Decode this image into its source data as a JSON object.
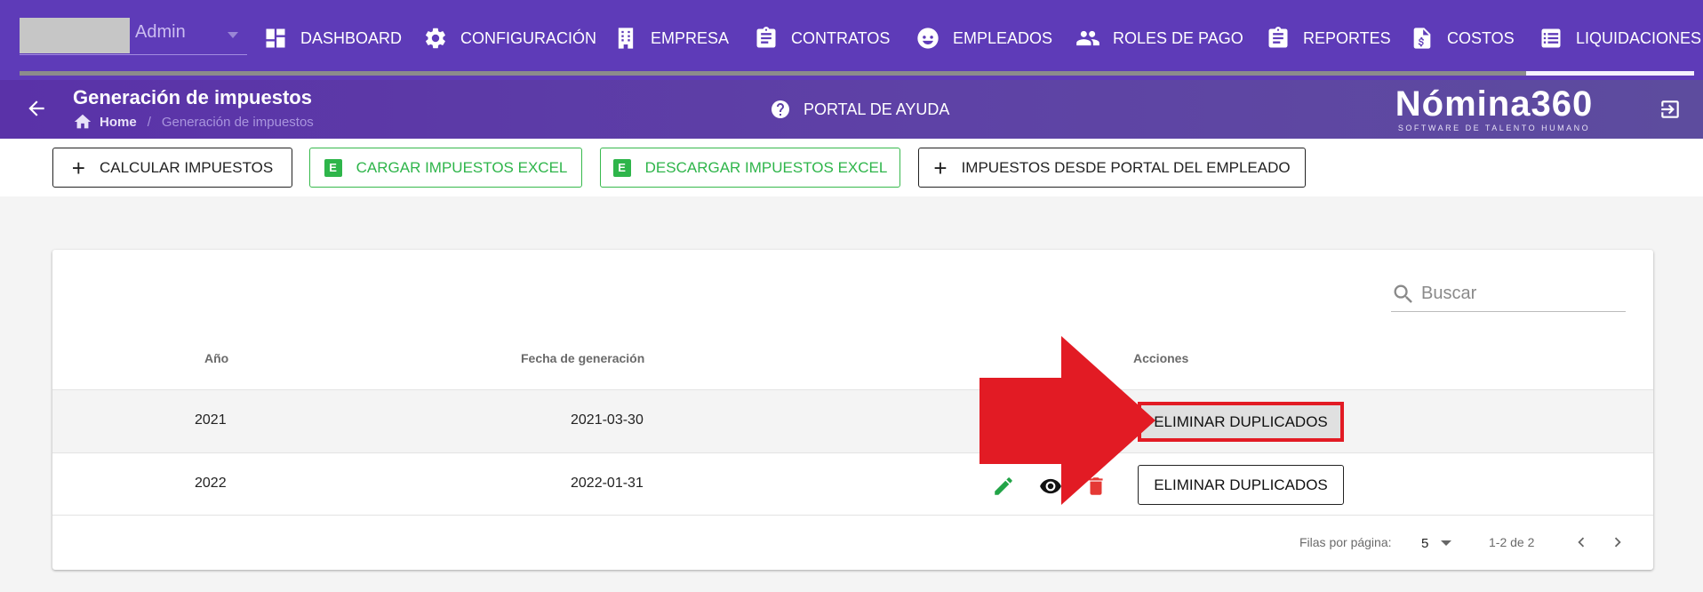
{
  "nav": {
    "user": {
      "name": "Admin"
    },
    "items": [
      {
        "label": "DASHBOARD",
        "icon": "dashboard-icon"
      },
      {
        "label": "CONFIGURACIÓN",
        "icon": "gear-icon"
      },
      {
        "label": "EMPRESA",
        "icon": "building-icon"
      },
      {
        "label": "CONTRATOS",
        "icon": "clipboard-icon"
      },
      {
        "label": "EMPLEADOS",
        "icon": "face-icon"
      },
      {
        "label": "ROLES DE PAGO",
        "icon": "people-icon"
      },
      {
        "label": "REPORTES",
        "icon": "clipboard-icon"
      },
      {
        "label": "COSTOS",
        "icon": "invoice-icon"
      },
      {
        "label": "LIQUIDACIONES",
        "icon": "list-icon"
      }
    ],
    "active": "LIQUIDACIONES"
  },
  "header": {
    "title": "Generación de impuestos",
    "breadcrumb": {
      "home": "Home",
      "separator": "/",
      "current": "Generación de impuestos"
    },
    "help": "PORTAL DE AYUDA",
    "brand": {
      "name": "Nómina360",
      "tagline": "SOFTWARE DE TALENTO HUMANO"
    }
  },
  "actions": {
    "calculate": "CALCULAR IMPUESTOS",
    "upload_excel": "CARGAR IMPUESTOS EXCEL",
    "download_excel": "DESCARGAR IMPUESTOS EXCEL",
    "from_portal": "IMPUESTOS DESDE PORTAL DEL EMPLEADO",
    "excel_letter": "E",
    "plus": "+"
  },
  "table": {
    "search_placeholder": "Buscar",
    "columns": {
      "year": "Año",
      "date": "Fecha de generación",
      "actions": "Acciones"
    },
    "rows": [
      {
        "year": "2021",
        "date": "2021-03-30",
        "action": "ELIMINAR DUPLICADOS",
        "highlighted": true
      },
      {
        "year": "2022",
        "date": "2022-01-31",
        "action": "ELIMINAR DUPLICADOS",
        "icons": [
          "pencil-icon",
          "eye-icon",
          "trash-icon"
        ]
      }
    ],
    "footer": {
      "rows_per_page_label": "Filas por página:",
      "rows_per_page": "5",
      "range": "1-2 de 2"
    }
  },
  "colors": {
    "nav_bg": "#5e3bb8",
    "excel_green": "#2eb54a",
    "annotation_red": "#e21b24",
    "edit_green": "#22a447",
    "delete_red": "#e53935"
  }
}
